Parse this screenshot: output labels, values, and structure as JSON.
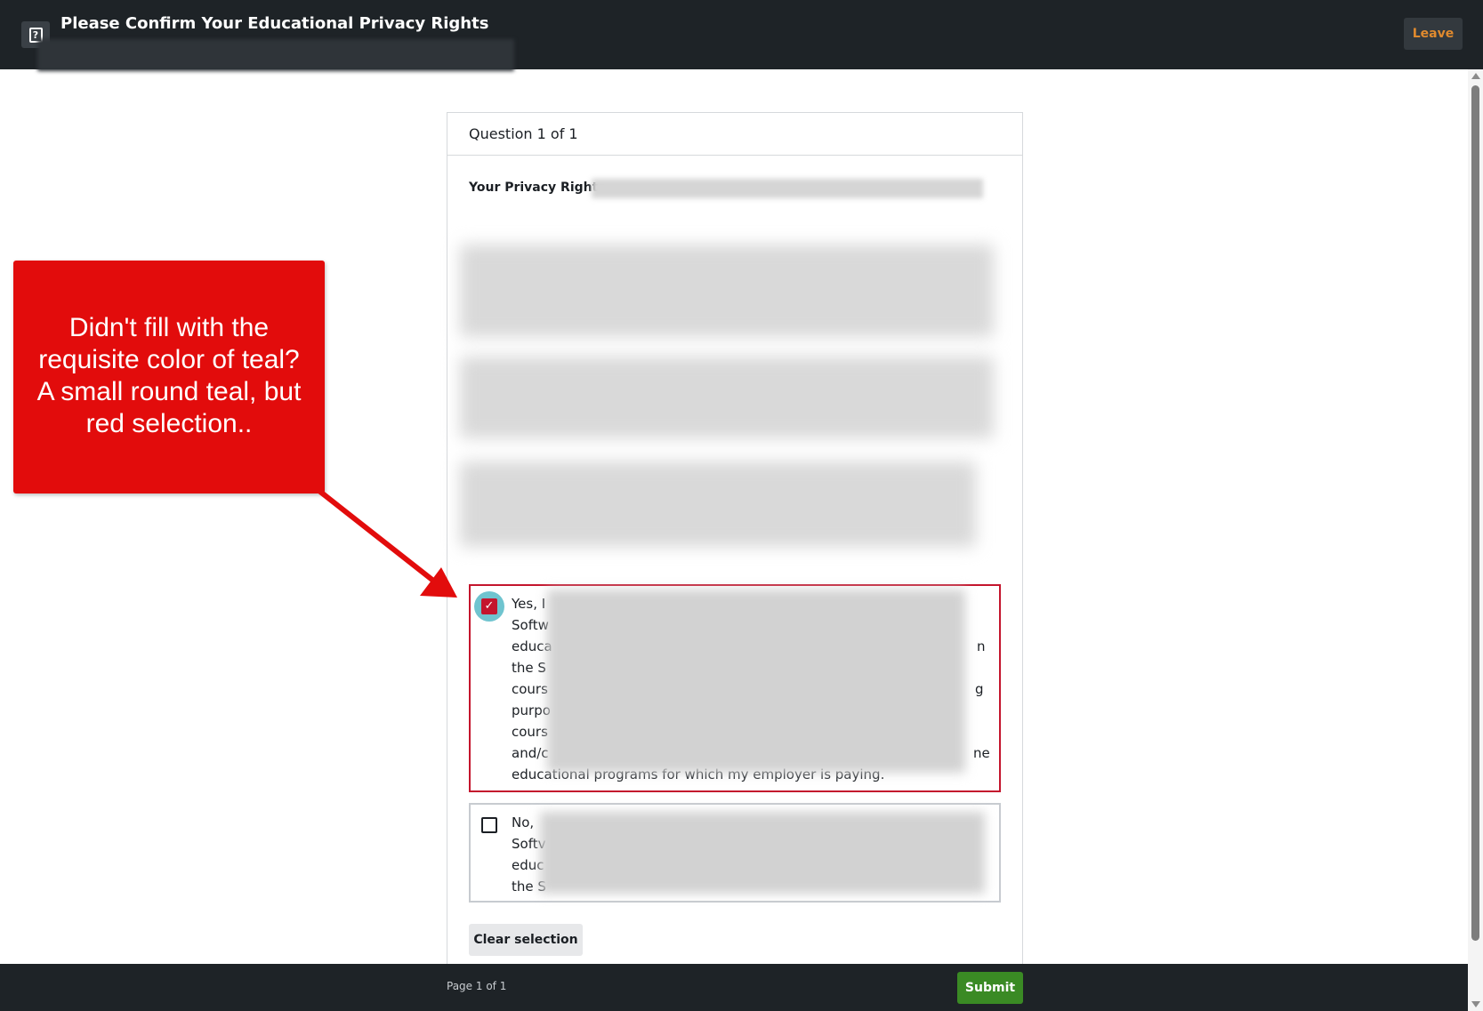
{
  "header": {
    "title": "Please Confirm Your Educational Privacy Rights",
    "leave_label": "Leave",
    "icon": "quiz-icon"
  },
  "question": {
    "counter": "Question 1 of 1",
    "privacy_label": "Your Privacy Rights",
    "options": [
      {
        "lines": [
          "Yes, I",
          "Softw",
          "educa",
          "the S",
          "cours",
          "purpo",
          "cours",
          "and/c",
          "educational programs for which my employer is paying."
        ],
        "tails": [
          "n",
          "g",
          "ne"
        ],
        "selected": true
      },
      {
        "lines": [
          "No,",
          "Softv",
          "educ",
          "the S"
        ],
        "selected": false
      }
    ],
    "clear_label": "Clear selection"
  },
  "footer": {
    "page_label": "Page 1 of 1",
    "submit_label": "Submit"
  },
  "annotation": {
    "text": "Didn't fill with the\nrequisite color of teal?\nA small round teal, but\nred selection..",
    "color": "#e20c0c"
  },
  "colors": {
    "topbar": "#1e2327",
    "selected_border": "#c4152d",
    "teal": "#6fc4cf",
    "submit": "#3a8a24",
    "leave_text": "#e08a2e"
  }
}
